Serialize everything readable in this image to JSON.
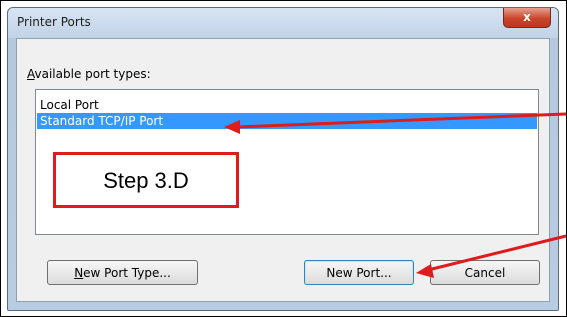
{
  "dialog": {
    "title": "Printer Ports",
    "close_glyph": "x"
  },
  "ports": {
    "label_accel": "A",
    "label_rest": "vailable port types:",
    "items": [
      "Local Port",
      "Standard TCP/IP Port"
    ],
    "selected_index": 1
  },
  "buttons": {
    "new_port_type_accel": "N",
    "new_port_type_rest": "ew Port Type...",
    "new_port": "New Port...",
    "cancel": "Cancel"
  },
  "annotation": {
    "step_label": "Step 3.D",
    "color": "#e01b1b"
  }
}
